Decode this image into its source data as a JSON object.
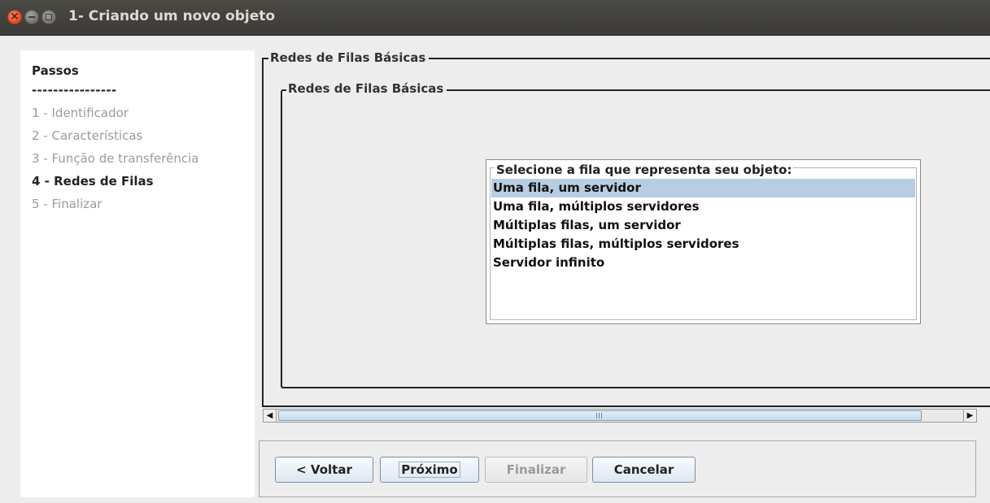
{
  "window": {
    "title": "1- Criando um novo objeto",
    "close_glyph": "×"
  },
  "sidebar": {
    "title": "Passos",
    "separator": "----------------",
    "steps": [
      {
        "label": "1 - Identificador",
        "active": false
      },
      {
        "label": "2 - Características",
        "active": false
      },
      {
        "label": "3 - Função de transferência",
        "active": false
      },
      {
        "label": "4 - Redes de Filas",
        "active": true
      },
      {
        "label": "5 - Finalizar",
        "active": false
      }
    ]
  },
  "main": {
    "outer_panel_title": "Redes de Filas Básicas",
    "inner_panel_title": "Redes de Filas Básicas",
    "queue_list": {
      "legend": "Selecione a fila que representa seu objeto:",
      "items": [
        "Uma fila, um servidor",
        "Uma fila, múltiplos servidores",
        "Múltiplas filas, um servidor",
        "Múltiplas filas, múltiplos servidores",
        "Servidor infinito"
      ],
      "selected_index": 0
    }
  },
  "scrollbar": {
    "left_arrow": "◀",
    "right_arrow": "▶"
  },
  "buttons": {
    "back": "< Voltar",
    "next": "Próximo",
    "finish": "Finalizar",
    "cancel": "Cancelar"
  },
  "colors": {
    "selection": "#b7cde2",
    "titlebar": "#3c3b37",
    "close_button": "#e0532a"
  }
}
